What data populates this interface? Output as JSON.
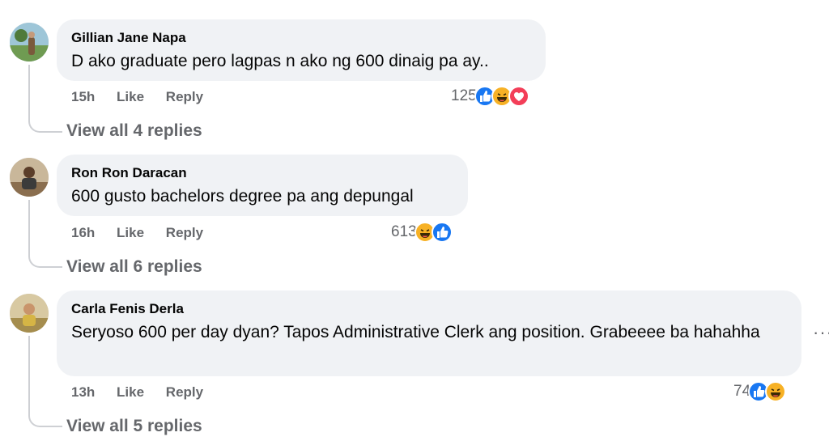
{
  "comments": [
    {
      "author": "Gillian Jane Napa",
      "text": "D ako graduate pero lagpas n ako ng 600 dinaig pa ay..",
      "time": "15h",
      "like_label": "Like",
      "reply_label": "Reply",
      "reaction_count": "125",
      "reactions": [
        "like-icon",
        "haha-icon",
        "love-icon"
      ],
      "view_replies": "View all 4 replies"
    },
    {
      "author": "Ron Ron Daracan",
      "text": "600 gusto bachelors degree pa ang depungal",
      "time": "16h",
      "like_label": "Like",
      "reply_label": "Reply",
      "reaction_count": "613",
      "reactions": [
        "haha-icon",
        "like-icon"
      ],
      "view_replies": "View all 6 replies"
    },
    {
      "author": "Carla Fenis Derla",
      "text": "Seryoso 600 per day dyan? Tapos Administrative Clerk ang position. Grabeeee ba hahahha",
      "time": "13h",
      "like_label": "Like",
      "reply_label": "Reply",
      "reaction_count": "74",
      "reactions": [
        "like-icon",
        "haha-icon"
      ],
      "view_replies": "View all 5 replies"
    }
  ],
  "more_options": "···",
  "colors": {
    "like": "#1877f2",
    "haha": "#f7b125",
    "love": "#f33e58",
    "bubble": "#f0f2f5",
    "meta": "#65676b"
  }
}
